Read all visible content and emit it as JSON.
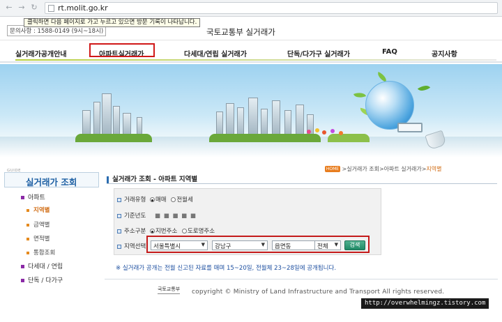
{
  "browser": {
    "url": "rt.molit.go.kr",
    "back_icon": "back-arrow-icon",
    "forward_icon": "forward-arrow-icon"
  },
  "topbar": {
    "tooltip": "클릭하면 다음 페이지로 가고 누르고 있으면 방문 기록이 나타납니다.",
    "inquiry": "문의사항 : 1588-0149 (9시~18시)",
    "site_title": "국토교통부 실거래가"
  },
  "nav": {
    "items": [
      {
        "label": "실거래가공개안내"
      },
      {
        "label": "아파트실거래가"
      },
      {
        "label": "다세대/연립 실거래가"
      },
      {
        "label": "단독/다가구 실거래가"
      },
      {
        "label": "FAQ"
      },
      {
        "label": "공지사항"
      }
    ],
    "highlight_color": "#d01818"
  },
  "sidebar": {
    "guide": "GUIDE",
    "title": "실거래가 조회",
    "sections": [
      {
        "label": "아파트"
      },
      {
        "label": "지역별"
      },
      {
        "label": "금액별"
      },
      {
        "label": "면적별"
      },
      {
        "label": "통합조회"
      },
      {
        "label": "다세대 / 연립"
      },
      {
        "label": "단독 / 다가구"
      }
    ]
  },
  "content": {
    "title": "실거래가 조회 - 아파트 지역별",
    "breadcrumb": {
      "home": "HOME",
      "path": ">실거래가 조회>아파트 실거래가>",
      "current": "지역별"
    },
    "form": {
      "trade_type_label": "거래유형",
      "trade_options": [
        "매매",
        "전월세"
      ],
      "trade_selected": "매매",
      "year_label": "기준년도",
      "year_value": "■ ■ ■ ■ ■",
      "address_label": "주소구분",
      "address_options": [
        "지번주소",
        "도로명주소"
      ],
      "address_selected": "지번주소",
      "region_label": "지역선택",
      "sido": "서울특별시",
      "sigungu": "강남구",
      "dong": "읍면동",
      "scope": "전체",
      "search_button": "검색"
    },
    "notice": "※ 실거래가 공개는 전월 신고된 자료를 매며 15~20일, 전월체 23~28일에 공개됩니다."
  },
  "footer": {
    "logo": "국토교통부",
    "copyright": "copyright © Ministry of Land Infrastructure and Transport All rights reserved."
  },
  "watermark": "http://overwhelmingz.tistory.com",
  "colors": {
    "accent_blue": "#1d5fa3",
    "active_orange": "#d06a10",
    "search_green": "#1f8a66",
    "highlight_red": "#c41a1a"
  }
}
